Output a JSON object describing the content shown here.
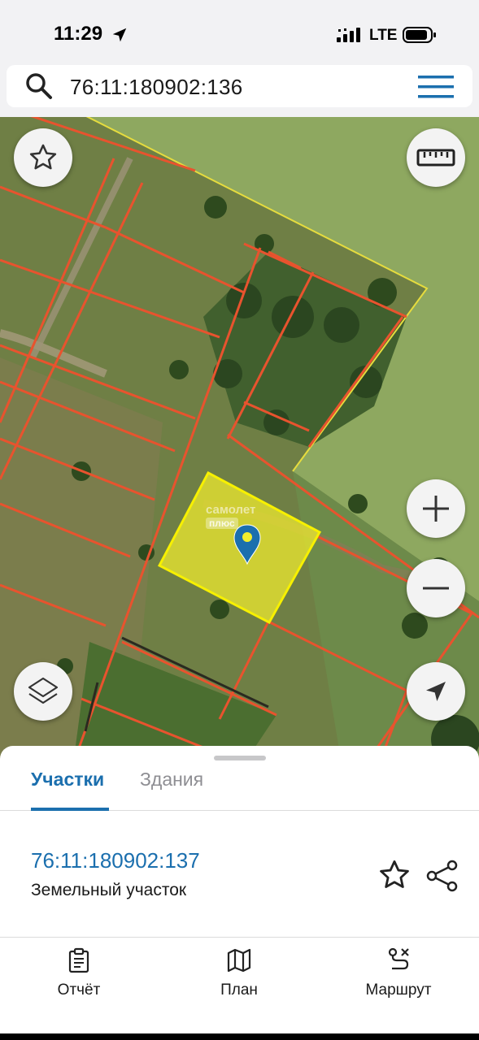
{
  "status_bar": {
    "time": "11:29",
    "network": "LTE"
  },
  "search": {
    "query": "76:11:180902:136",
    "search_icon": "search-icon",
    "menu_icon": "hamburger-menu-icon"
  },
  "map": {
    "watermark_main": "самолет",
    "watermark_sub": "плюс",
    "selected_parcel_color": "#f2ef2e",
    "boundary_color": "#e8532e",
    "controls": {
      "favorite_icon": "star-icon",
      "ruler_icon": "ruler-icon",
      "zoom_in_icon": "plus-icon",
      "zoom_out_icon": "minus-icon",
      "layers_icon": "layers-icon",
      "location_icon": "navigation-arrow-icon"
    }
  },
  "sheet": {
    "tabs": [
      {
        "label": "Участки",
        "active": true
      },
      {
        "label": "Здания",
        "active": false
      }
    ],
    "parcel": {
      "number": "76:11:180902:137",
      "type": "Земельный участок"
    }
  },
  "bottom_nav": {
    "items": [
      {
        "label": "Отчёт",
        "icon": "report-clipboard-icon"
      },
      {
        "label": "План",
        "icon": "map-plan-icon"
      },
      {
        "label": "Маршрут",
        "icon": "route-icon"
      }
    ]
  },
  "colors": {
    "accent": "#1b6fae",
    "inactive": "#8e8e93"
  }
}
